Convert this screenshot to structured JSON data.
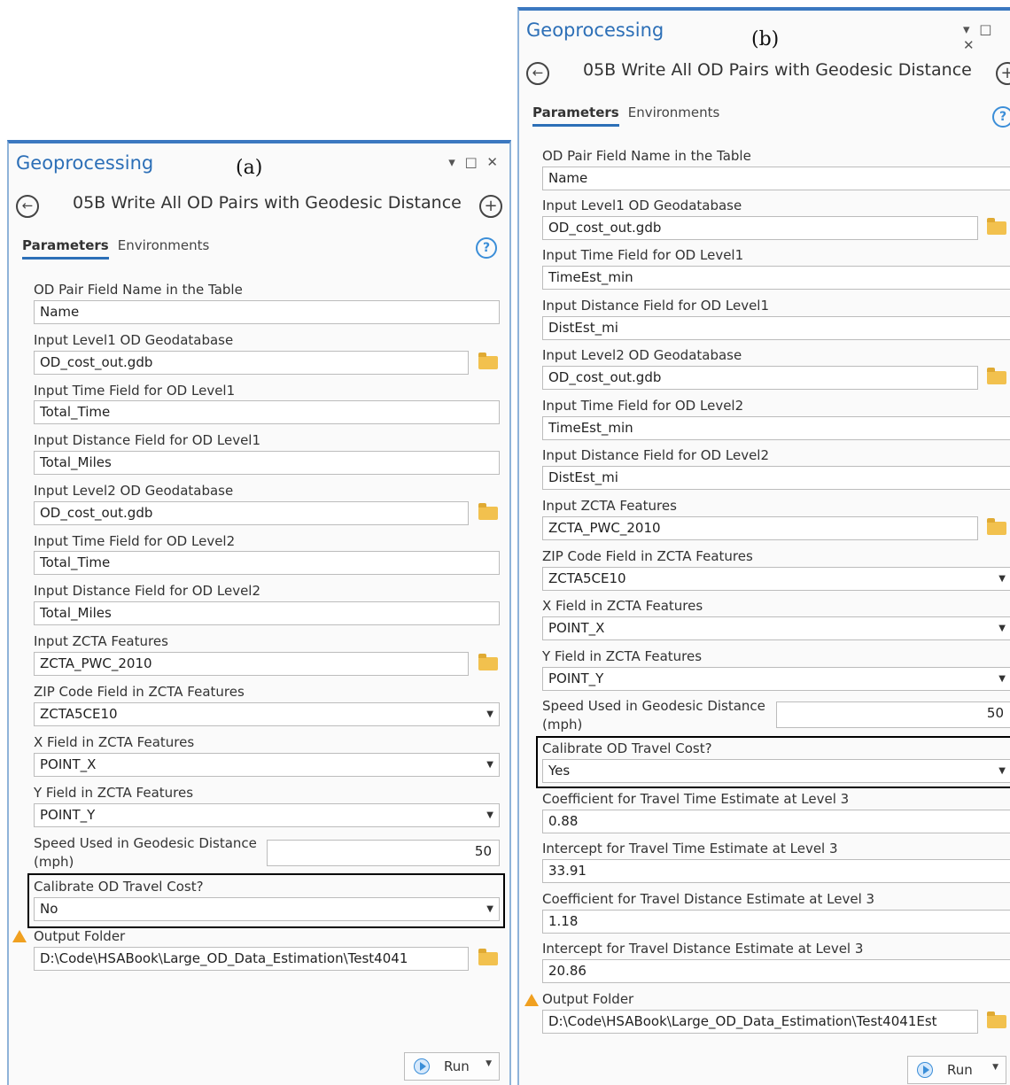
{
  "panels": {
    "a": {
      "caption": "(a)",
      "window_title": "Geoprocessing",
      "window_controls": "▾ □ ✕",
      "tool_title": "05B Write All OD Pairs with Geodesic Distance",
      "tabs": [
        "Parameters",
        "Environments"
      ],
      "params": {
        "od_pair_field": {
          "label": "OD Pair Field Name in the Table",
          "value": "Name"
        },
        "level1_gdb": {
          "label": "Input Level1 OD Geodatabase",
          "value": "OD_cost_out.gdb"
        },
        "time_level1": {
          "label": "Input Time Field for OD Level1",
          "value": "Total_Time"
        },
        "dist_level1": {
          "label": "Input Distance Field for OD Level1",
          "value": "Total_Miles"
        },
        "level2_gdb": {
          "label": "Input Level2 OD Geodatabase",
          "value": "OD_cost_out.gdb"
        },
        "time_level2": {
          "label": "Input Time Field for OD Level2",
          "value": "Total_Time"
        },
        "dist_level2": {
          "label": "Input Distance Field for OD Level2",
          "value": "Total_Miles"
        },
        "zcta_features": {
          "label": "Input ZCTA Features",
          "value": "ZCTA_PWC_2010"
        },
        "zip_field": {
          "label": "ZIP Code Field in ZCTA Features",
          "value": "ZCTA5CE10"
        },
        "x_field": {
          "label": "X Field in ZCTA Features",
          "value": "POINT_X"
        },
        "y_field": {
          "label": "Y Field in ZCTA Features",
          "value": "POINT_Y"
        },
        "speed": {
          "label_line1": "Speed Used in Geodesic Distance",
          "label_line2": "(mph)",
          "value": "50"
        },
        "calibrate": {
          "label": "Calibrate OD Travel Cost?",
          "value": "No"
        },
        "output_folder": {
          "label": "Output Folder",
          "value": "D:\\Code\\HSABook\\Large_OD_Data_Estimation\\Test4041"
        }
      },
      "run_label": "Run"
    },
    "b": {
      "caption": "(b)",
      "window_title": "Geoprocessing",
      "window_controls": "▾ □ ✕",
      "tool_title": "05B Write All OD Pairs with Geodesic Distance",
      "tabs": [
        "Parameters",
        "Environments"
      ],
      "params": {
        "od_pair_field": {
          "label": "OD Pair Field Name in the Table",
          "value": "Name"
        },
        "level1_gdb": {
          "label": "Input Level1 OD Geodatabase",
          "value": "OD_cost_out.gdb"
        },
        "time_level1": {
          "label": "Input Time Field for OD Level1",
          "value": "TimeEst_min"
        },
        "dist_level1": {
          "label": "Input Distance Field for OD Level1",
          "value": "DistEst_mi"
        },
        "level2_gdb": {
          "label": "Input Level2 OD Geodatabase",
          "value": "OD_cost_out.gdb"
        },
        "time_level2": {
          "label": "Input Time Field for OD Level2",
          "value": "TimeEst_min"
        },
        "dist_level2": {
          "label": "Input Distance Field for OD Level2",
          "value": "DistEst_mi"
        },
        "zcta_features": {
          "label": "Input ZCTA Features",
          "value": "ZCTA_PWC_2010"
        },
        "zip_field": {
          "label": "ZIP Code Field in ZCTA Features",
          "value": "ZCTA5CE10"
        },
        "x_field": {
          "label": "X Field in ZCTA Features",
          "value": "POINT_X"
        },
        "y_field": {
          "label": "Y Field in ZCTA Features",
          "value": "POINT_Y"
        },
        "speed": {
          "label_line1": "Speed Used in Geodesic Distance",
          "label_line2": "(mph)",
          "value": "50"
        },
        "calibrate": {
          "label": "Calibrate OD Travel Cost?",
          "value": "Yes"
        },
        "coef_time": {
          "label": "Coefficient for Travel Time Estimate at Level 3",
          "value": "0.88"
        },
        "int_time": {
          "label": "Intercept for Travel Time Estimate at Level 3",
          "value": "33.91"
        },
        "coef_dist": {
          "label": "Coefficient for Travel Distance Estimate at Level 3",
          "value": "1.18"
        },
        "int_dist": {
          "label": "Intercept for Travel Distance Estimate at Level 3",
          "value": "20.86"
        },
        "output_folder": {
          "label": "Output Folder",
          "value": "D:\\Code\\HSABook\\Large_OD_Data_Estimation\\Test4041Est"
        }
      },
      "run_label": "Run"
    }
  },
  "colors": {
    "accent": "#2c6fb7",
    "folder": "#f2c14e",
    "warning": "#f0a020"
  }
}
